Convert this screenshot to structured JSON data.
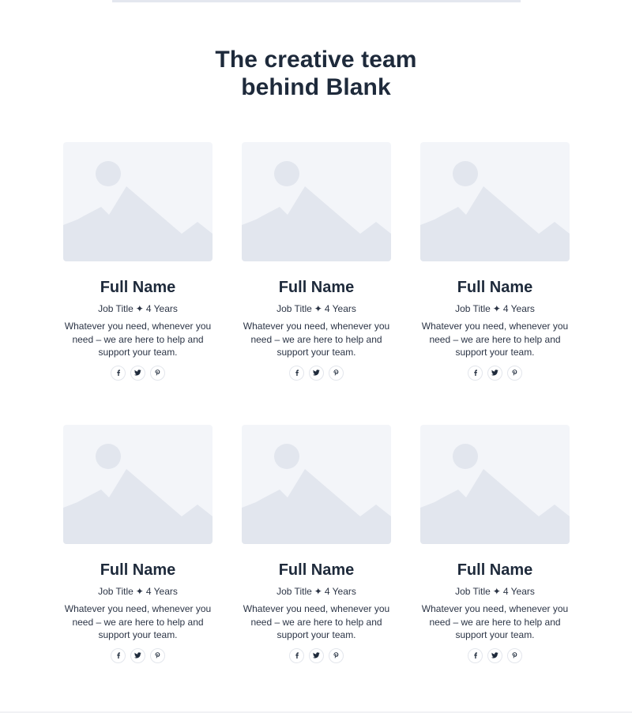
{
  "section": {
    "title_line1": "The creative team",
    "title_line2": "behind Blank"
  },
  "colors": {
    "heading": "#1e2a3b",
    "placeholder_bg": "#f3f5f9",
    "placeholder_shape": "#e2e6ee"
  },
  "members": [
    {
      "name": "Full Name",
      "job_title": "Job Title",
      "separator": "✦",
      "years": "4 Years",
      "description": "Whatever you need, whenever you need – we are here to help and support your team.",
      "socials": [
        "facebook-icon",
        "twitter-icon",
        "pinterest-icon"
      ]
    },
    {
      "name": "Full Name",
      "job_title": "Job Title",
      "separator": "✦",
      "years": "4 Years",
      "description": "Whatever you need, whenever you need – we are here to help and support your team.",
      "socials": [
        "facebook-icon",
        "twitter-icon",
        "pinterest-icon"
      ]
    },
    {
      "name": "Full Name",
      "job_title": "Job Title",
      "separator": "✦",
      "years": "4 Years",
      "description": "Whatever you need, whenever you need – we are here to help and support your team.",
      "socials": [
        "facebook-icon",
        "twitter-icon",
        "pinterest-icon"
      ]
    },
    {
      "name": "Full Name",
      "job_title": "Job Title",
      "separator": "✦",
      "years": "4 Years",
      "description": "Whatever you need, whenever you need – we are here to help and support your team.",
      "socials": [
        "facebook-icon",
        "twitter-icon",
        "pinterest-icon"
      ]
    },
    {
      "name": "Full Name",
      "job_title": "Job Title",
      "separator": "✦",
      "years": "4 Years",
      "description": "Whatever you need, whenever you need – we are here to help and support your team.",
      "socials": [
        "facebook-icon",
        "twitter-icon",
        "pinterest-icon"
      ]
    },
    {
      "name": "Full Name",
      "job_title": "Job Title",
      "separator": "✦",
      "years": "4 Years",
      "description": "Whatever you need, whenever you need – we are here to help and support your team.",
      "socials": [
        "facebook-icon",
        "twitter-icon",
        "pinterest-icon"
      ]
    }
  ]
}
